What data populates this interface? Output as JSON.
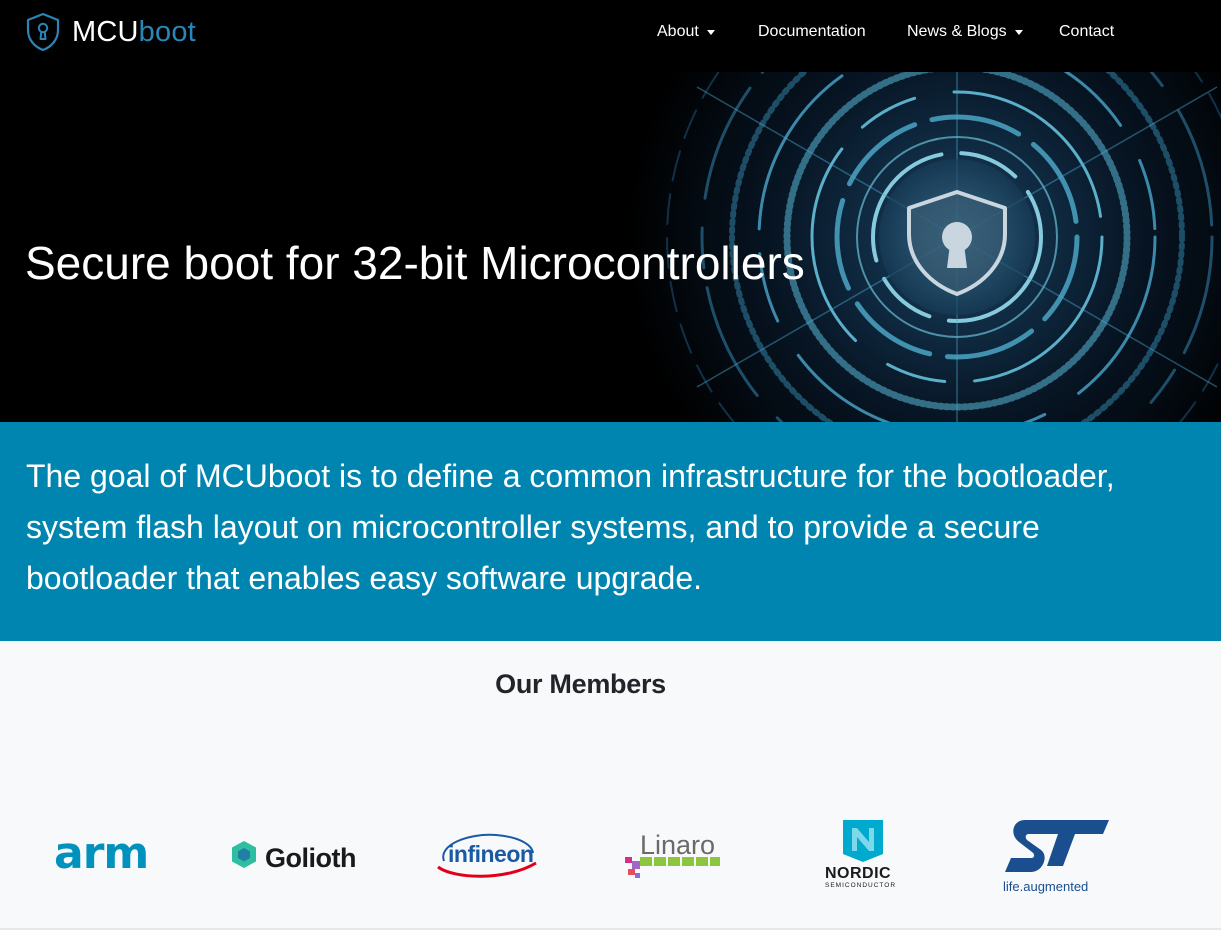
{
  "brand": {
    "part1": "MCU",
    "part2": "boot",
    "icon": "shield-keyhole-icon",
    "accent": "#2a86b8"
  },
  "nav": {
    "items": [
      {
        "label": "About",
        "dropdown": true
      },
      {
        "label": "Documentation",
        "dropdown": false
      },
      {
        "label": "News & Blogs",
        "dropdown": true
      },
      {
        "label": "Contact",
        "dropdown": false
      }
    ]
  },
  "hero": {
    "title": "Secure boot for 32-bit Microcontrollers",
    "art": "shield-lock-circuit-icon"
  },
  "mission": {
    "text": "The goal of MCUboot is to define a common infrastructure for the bootloader, system flash layout on microcontroller systems, and to provide a secure bootloader that enables easy software upgrade.",
    "background": "#0085b0"
  },
  "members": {
    "title": "Our Members",
    "logos": [
      {
        "name": "arm",
        "color": "#0091bd"
      },
      {
        "name": "Golioth",
        "color": "#1a1a1a"
      },
      {
        "name": "infineon",
        "color": "#1a5aa3"
      },
      {
        "name": "Linaro",
        "color": "#6a6a6a"
      },
      {
        "name": "NORDIC",
        "subtitle": "SEMICONDUCTOR",
        "color": "#00a9ce"
      },
      {
        "name": "life.augmented",
        "color": "#1a4e8f"
      }
    ]
  }
}
